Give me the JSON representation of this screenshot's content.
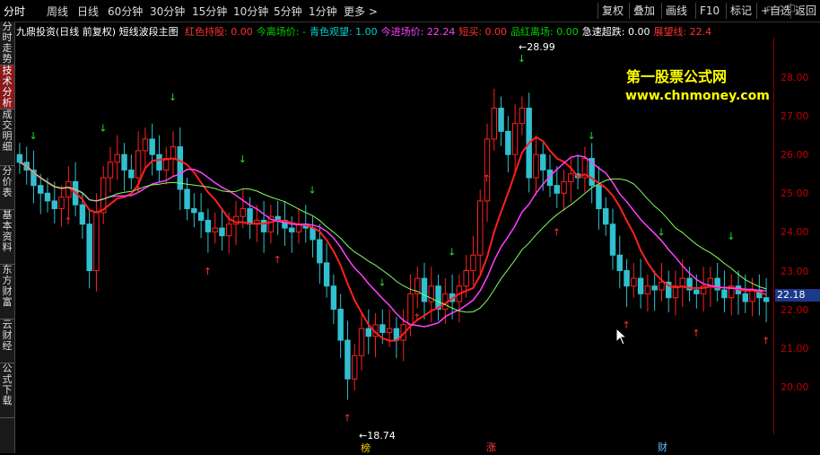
{
  "tabs": [
    "分时",
    "周线",
    "日线",
    "60分钟",
    "30分钟",
    "15分钟",
    "10分钟",
    "5分钟",
    "1分钟",
    "更多 >"
  ],
  "right_buttons": [
    "复权",
    "叠加",
    "画线",
    "F10",
    "标记",
    "+自选",
    "返回"
  ],
  "left_tabs": [
    "分时走势",
    "技术分析",
    "成交明细",
    "分价表",
    "基本资料",
    "东方财富",
    "云财经",
    "公式下载"
  ],
  "indicator": {
    "title": "九鼎投资(日线 前复权) 短线波段主图",
    "items": [
      {
        "label": "红色持股: 0.00",
        "color": "#ff3030"
      },
      {
        "label": "今离场价: -",
        "color": "#00d000"
      },
      {
        "label": "青色观望: 1.00",
        "color": "#00d0d0"
      },
      {
        "label": "今进场价: 22.24",
        "color": "#ff40ff"
      },
      {
        "label": "短买: 0.00",
        "color": "#ff3030"
      },
      {
        "label": "品红离场: 0.00",
        "color": "#00d000"
      },
      {
        "label": "急速超跌: 0.00",
        "color": "#ffffff"
      },
      {
        "label": "展望线: 22.4",
        "color": "#ff3030"
      }
    ]
  },
  "y_ticks": [
    "28.00",
    "27.00",
    "26.00",
    "25.00",
    "24.00",
    "23.00",
    "22.00",
    "21.00",
    "20.00"
  ],
  "current_price": "22.18",
  "high_label": "28.99",
  "low_label": "18.74",
  "watermark": {
    "line1": "第一股票公式网",
    "line2": "www.chnmoney.com"
  },
  "bottom_badges": [
    "榜",
    "涨",
    "财"
  ],
  "top_icons": "▭ ◇ □",
  "chart_data": {
    "type": "candlestick",
    "y_range": [
      19.5,
      29.0
    ],
    "up_color": "#ff2020",
    "down_color": "#30c0d0"
  }
}
